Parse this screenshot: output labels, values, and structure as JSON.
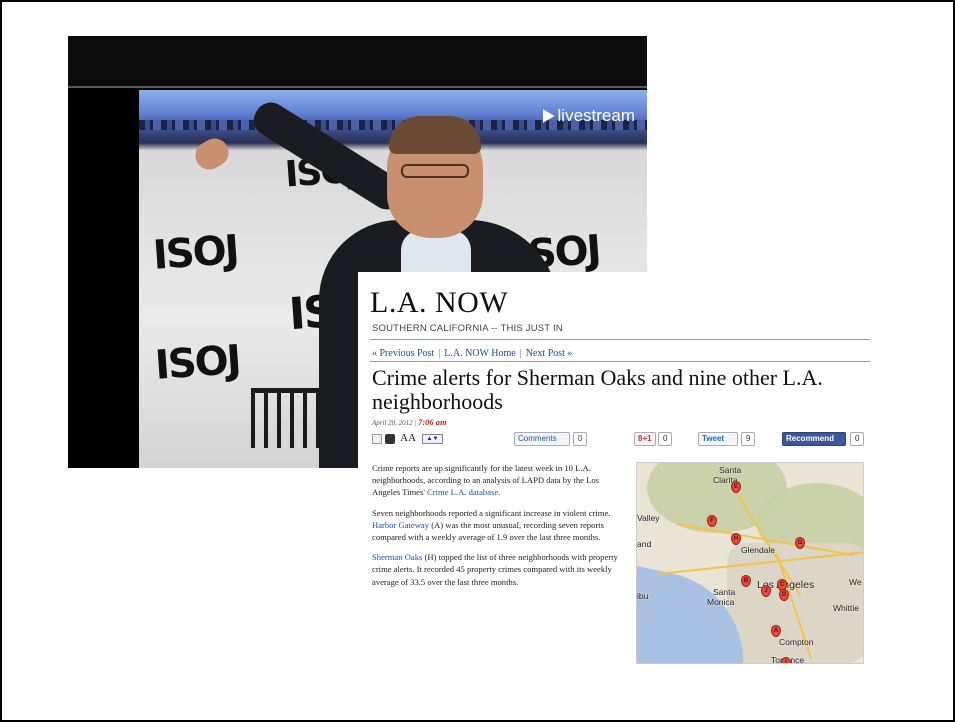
{
  "video": {
    "watermark": "livestream",
    "backdrop_logo": "ISOJ"
  },
  "article": {
    "blog_title": "L.A. NOW",
    "blog_subtitle": "SOUTHERN CALIFORNIA -- THIS JUST IN",
    "nav": {
      "previous": "« Previous Post",
      "home": "L.A. NOW Home",
      "next": "Next Post »",
      "separator": "|"
    },
    "headline": "Crime alerts for Sherman Oaks and nine other L.A. neighborhoods",
    "date": "April 20, 2012",
    "date_separator": "|",
    "time": "7:06 am",
    "toolbar": {
      "text_size_label": "AA",
      "stepper_symbols": "▲▼",
      "comments_label": "Comments",
      "comments_count": "0",
      "gplus_label": "8+1",
      "gplus_count": "0",
      "tweet_label": "Tweet",
      "tweet_count": "9",
      "recommend_label": "Recommend",
      "recommend_count": "0"
    },
    "paragraphs": {
      "p1_text": "Crime reports are up significantly for the latest week in 10 L.A. neighborhoods, according to an analysis of LAPD data by the Los Angeles Times'",
      "p1_link": "Crime L.A. database",
      "p1_end": ".",
      "p2_start": "Seven neighborhoods reported a significant increase in violent crime.",
      "p2_link": "Harbor Gateway",
      "p2_end": "(A) was the most unusual, recording seven reports compared with a weekly average of 1.9 over the last three months.",
      "p3_link": "Sherman Oaks",
      "p3_end": "(H) topped the list of three neighborhoods with property crime alerts. It recorded 45 property crimes compared with its weekly average of 33.5 over the last three months."
    },
    "map": {
      "labels": {
        "santa_clarita": "Santa Clarita",
        "valley": "Valley",
        "and": "and",
        "glendale": "Glendale",
        "los_angeles": "Los Angeles",
        "santa_monica": "Santa Monica",
        "malibu": "ibu",
        "whittier": "Whittie",
        "we": "We",
        "compton": "Compton",
        "torrance": "Torrance"
      },
      "pins": [
        "E",
        "F",
        "H",
        "G",
        "B",
        "J",
        "C",
        "D",
        "A",
        "I"
      ],
      "pin_color": "#e8493a"
    }
  }
}
